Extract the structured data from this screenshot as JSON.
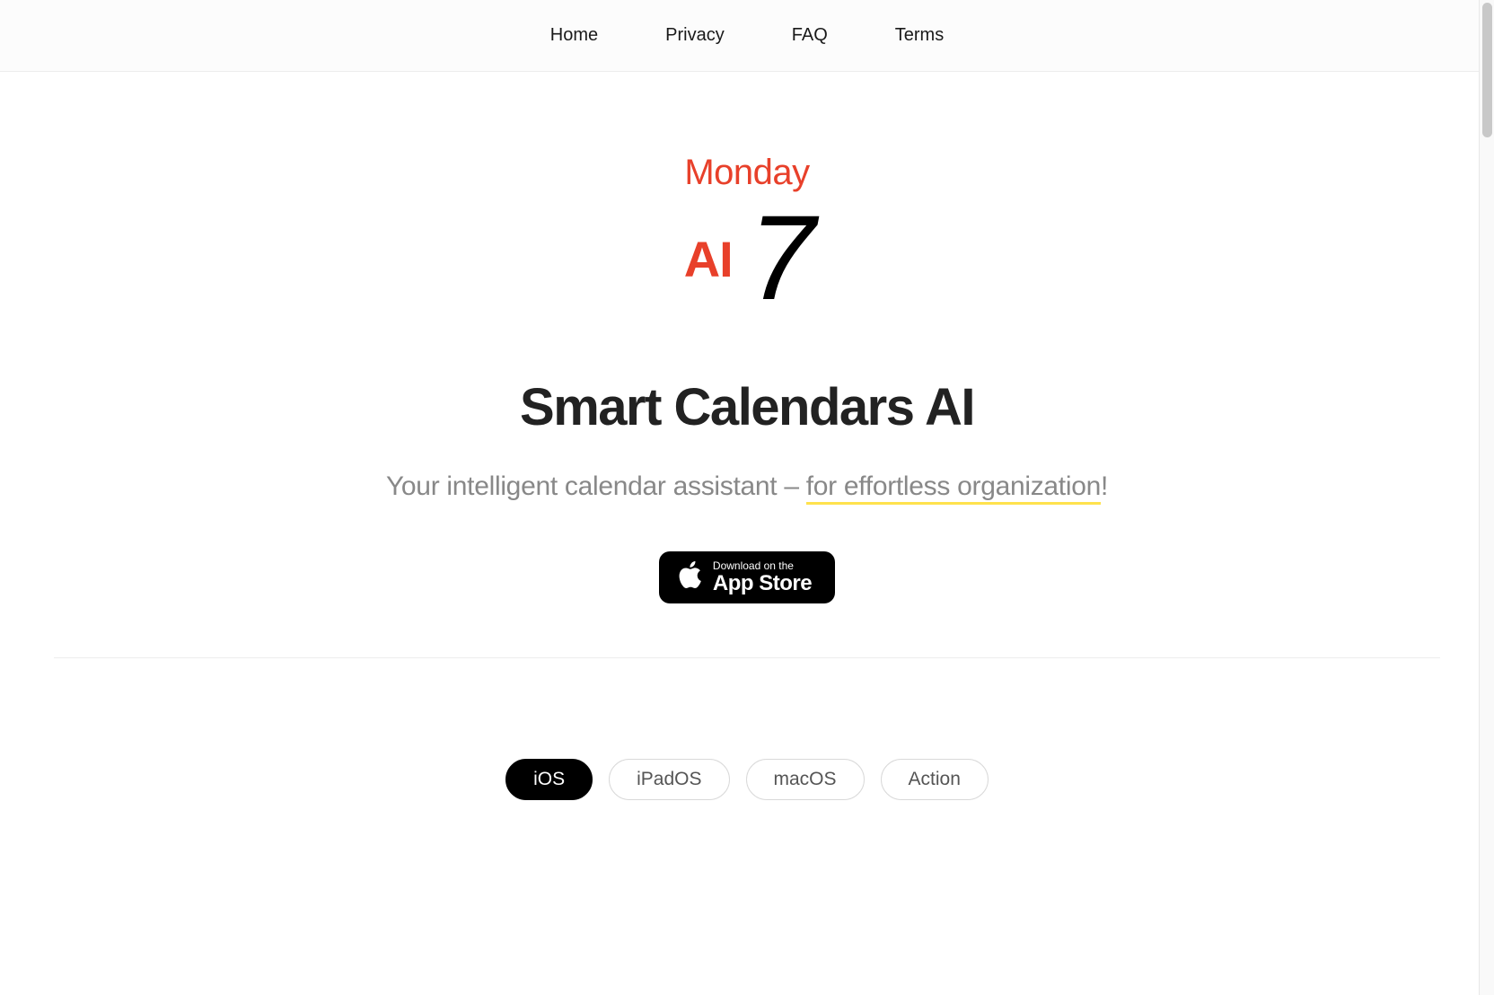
{
  "nav": {
    "items": [
      "Home",
      "Privacy",
      "FAQ",
      "Terms"
    ]
  },
  "logo": {
    "day": "Monday",
    "ai": "AI",
    "num": "7"
  },
  "hero": {
    "title": "Smart Calendars AI",
    "sub_prefix": "Your intelligent calendar assistant – ",
    "sub_u1": "for effortless or",
    "sub_u2": "ganization",
    "sub_suffix": "!"
  },
  "store": {
    "small": "Download on the",
    "big": "App Store"
  },
  "tabs": {
    "items": [
      {
        "label": "iOS",
        "active": true
      },
      {
        "label": "iPadOS",
        "active": false
      },
      {
        "label": "macOS",
        "active": false
      },
      {
        "label": "Action",
        "active": false
      }
    ]
  }
}
